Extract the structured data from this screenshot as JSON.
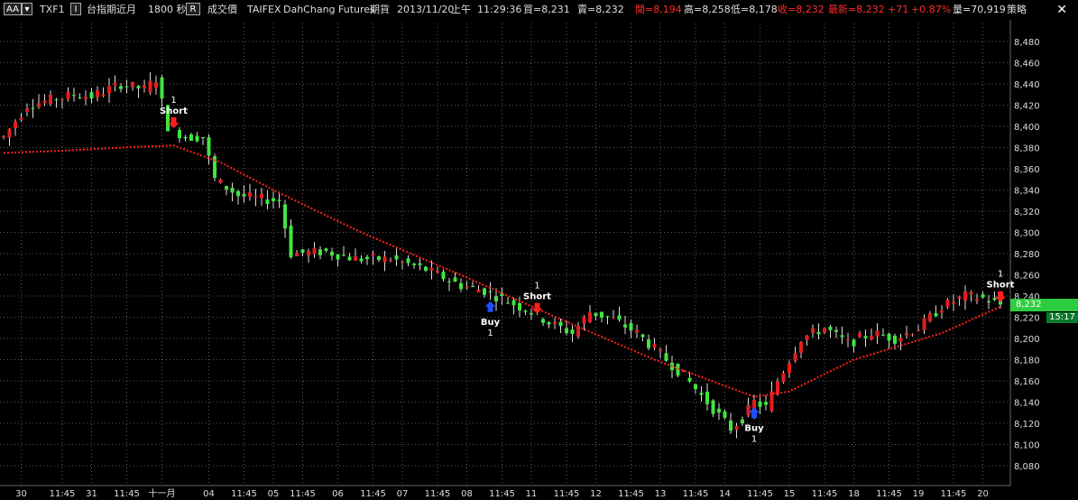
{
  "toolbar": {
    "aa_label": "AA",
    "symbol": "TXF1",
    "toggle_label": "I",
    "name": "台指期近月",
    "interval": "1800 秒",
    "r_label": "R",
    "price_type": "成交價",
    "exchange": "TAIFEX",
    "broker": "DahChang Futures",
    "market": "期貨",
    "date": "2013/11/20",
    "session": "上午",
    "time": "11:29:36",
    "bid": "買=8,231",
    "ask": "賣=8,232",
    "open": "開=8,194",
    "high": "高=8,258",
    "low": "低=8,178",
    "close": "收=8,232",
    "last": "最新=8,232",
    "change": "+71",
    "change_pct": "+0.87%",
    "volume": "量=70,919",
    "strategy": "策略",
    "close_symbol": "✕"
  },
  "colors": {
    "up": "#e31e1e",
    "down": "#3ee63e",
    "ma": "#ff2020",
    "buy": "#1e4fff",
    "sell": "#ff2020",
    "grid": "#5a5a5a",
    "header_red": "#ff2a2a"
  },
  "price_tag": "8,232",
  "time_tag": "15:17",
  "chart_data": {
    "type": "candlestick",
    "ylim": [
      8080,
      8480
    ],
    "yticks": [
      8480,
      8460,
      8440,
      8420,
      8400,
      8380,
      8360,
      8340,
      8320,
      8300,
      8280,
      8260,
      8240,
      8220,
      8200,
      8180,
      8160,
      8140,
      8120,
      8100,
      8080
    ],
    "ytick_labels": [
      "8,480",
      "8,460",
      "8,440",
      "8,420",
      "8,400",
      "8,380",
      "8,360",
      "8,340",
      "8,320",
      "8,300",
      "8,280",
      "8,260",
      "8,240",
      "8,220",
      "8,200",
      "8,180",
      "8,160",
      "8,140",
      "8,120",
      "8,100",
      "8,080"
    ],
    "xtick_labels": [
      {
        "i": 3,
        "label": "30"
      },
      {
        "i": 10,
        "label": "11:45"
      },
      {
        "i": 15,
        "label": "31"
      },
      {
        "i": 21,
        "label": "11:45"
      },
      {
        "i": 27,
        "label": "十一月"
      },
      {
        "i": 35,
        "label": "04"
      },
      {
        "i": 41,
        "label": "11:45"
      },
      {
        "i": 46,
        "label": "05"
      },
      {
        "i": 51,
        "label": "11:45"
      },
      {
        "i": 57,
        "label": "06"
      },
      {
        "i": 63,
        "label": "11:45"
      },
      {
        "i": 68,
        "label": "07"
      },
      {
        "i": 74,
        "label": "11:45"
      },
      {
        "i": 79,
        "label": "08"
      },
      {
        "i": 85,
        "label": "11:45"
      },
      {
        "i": 90,
        "label": "11"
      },
      {
        "i": 96,
        "label": "11:45"
      },
      {
        "i": 101,
        "label": "12"
      },
      {
        "i": 107,
        "label": "11:45"
      },
      {
        "i": 112,
        "label": "13"
      },
      {
        "i": 118,
        "label": "11:45"
      },
      {
        "i": 123,
        "label": "14"
      },
      {
        "i": 129,
        "label": "11:45"
      },
      {
        "i": 134,
        "label": "15"
      },
      {
        "i": 140,
        "label": "11:45"
      },
      {
        "i": 145,
        "label": "18"
      },
      {
        "i": 151,
        "label": "11:45"
      },
      {
        "i": 156,
        "label": "19"
      },
      {
        "i": 162,
        "label": "11:45"
      },
      {
        "i": 167,
        "label": "20"
      }
    ],
    "waypoints": [
      [
        0,
        8390
      ],
      [
        4,
        8420
      ],
      [
        8,
        8425
      ],
      [
        12,
        8430
      ],
      [
        15,
        8428
      ],
      [
        20,
        8440
      ],
      [
        24,
        8435
      ],
      [
        26,
        8445
      ],
      [
        28,
        8400
      ],
      [
        31,
        8390
      ],
      [
        34,
        8390
      ],
      [
        36,
        8350
      ],
      [
        40,
        8335
      ],
      [
        43,
        8332
      ],
      [
        47,
        8330
      ],
      [
        49,
        8280
      ],
      [
        55,
        8282
      ],
      [
        60,
        8275
      ],
      [
        66,
        8275
      ],
      [
        72,
        8265
      ],
      [
        78,
        8250
      ],
      [
        82,
        8245
      ],
      [
        86,
        8235
      ],
      [
        90,
        8225
      ],
      [
        93,
        8215
      ],
      [
        97,
        8205
      ],
      [
        100,
        8225
      ],
      [
        104,
        8218
      ],
      [
        108,
        8205
      ],
      [
        112,
        8185
      ],
      [
        116,
        8165
      ],
      [
        120,
        8140
      ],
      [
        124,
        8115
      ],
      [
        126,
        8125
      ],
      [
        128,
        8140
      ],
      [
        130,
        8135
      ],
      [
        132,
        8160
      ],
      [
        134,
        8180
      ],
      [
        136,
        8200
      ],
      [
        140,
        8210
      ],
      [
        144,
        8195
      ],
      [
        148,
        8205
      ],
      [
        152,
        8200
      ],
      [
        156,
        8210
      ],
      [
        160,
        8230
      ],
      [
        164,
        8240
      ],
      [
        167,
        8238
      ],
      [
        170,
        8232
      ]
    ],
    "ma_series": [
      [
        0,
        8375
      ],
      [
        10,
        8377
      ],
      [
        20,
        8380
      ],
      [
        29,
        8382
      ],
      [
        37,
        8366
      ],
      [
        46,
        8340
      ],
      [
        61,
        8300
      ],
      [
        80,
        8255
      ],
      [
        93,
        8223
      ],
      [
        111,
        8180
      ],
      [
        128,
        8145
      ],
      [
        134,
        8150
      ],
      [
        145,
        8180
      ],
      [
        160,
        8205
      ],
      [
        170,
        8230
      ]
    ],
    "signals": [
      {
        "i": 29,
        "price": 8400,
        "side": "sell",
        "label": "Short",
        "qty": "1"
      },
      {
        "i": 83,
        "price": 8230,
        "side": "buy",
        "label": "Buy",
        "qty": "1"
      },
      {
        "i": 91,
        "price": 8225,
        "side": "sell",
        "label": "Short",
        "qty": "1"
      },
      {
        "i": 128,
        "price": 8130,
        "side": "buy",
        "label": "Buy",
        "qty": "1"
      },
      {
        "i": 170,
        "price": 8236,
        "side": "sell",
        "label": "Short",
        "qty": "1"
      }
    ]
  }
}
